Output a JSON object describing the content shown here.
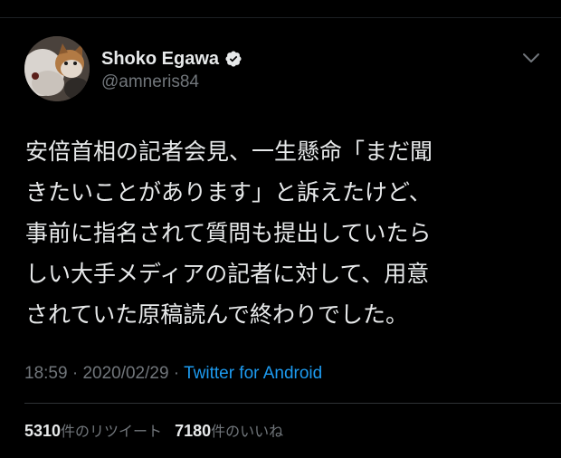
{
  "author": {
    "display_name": "Shoko Egawa",
    "handle": "@amneris84",
    "verified": true,
    "avatar_icon": "cat-photo-avatar"
  },
  "tweet": {
    "lines": [
      "安倍首相の記者会見、一生懸命「まだ聞",
      "きたいことがあります」と訴えたけど、",
      "事前に指名されて質問も提出していたら",
      "しい大手メディアの記者に対して、用意",
      "されていた原稿読んで終わりでした。"
    ]
  },
  "meta": {
    "time": "18:59",
    "separator_1": " · ",
    "date": "2020/02/29",
    "separator_2": " · ",
    "source": "Twitter for Android"
  },
  "stats": {
    "retweets_count": "5310",
    "retweets_label": "件のリツイート",
    "likes_count": "7180",
    "likes_label": "件のいいね"
  },
  "icons": {
    "verified": "verified-badge-icon",
    "more": "chevron-down-icon"
  },
  "colors": {
    "background": "#000000",
    "text_primary": "#e7e9ea",
    "text_secondary": "#71767b",
    "link": "#1d9bf0",
    "divider": "#2f3336"
  }
}
